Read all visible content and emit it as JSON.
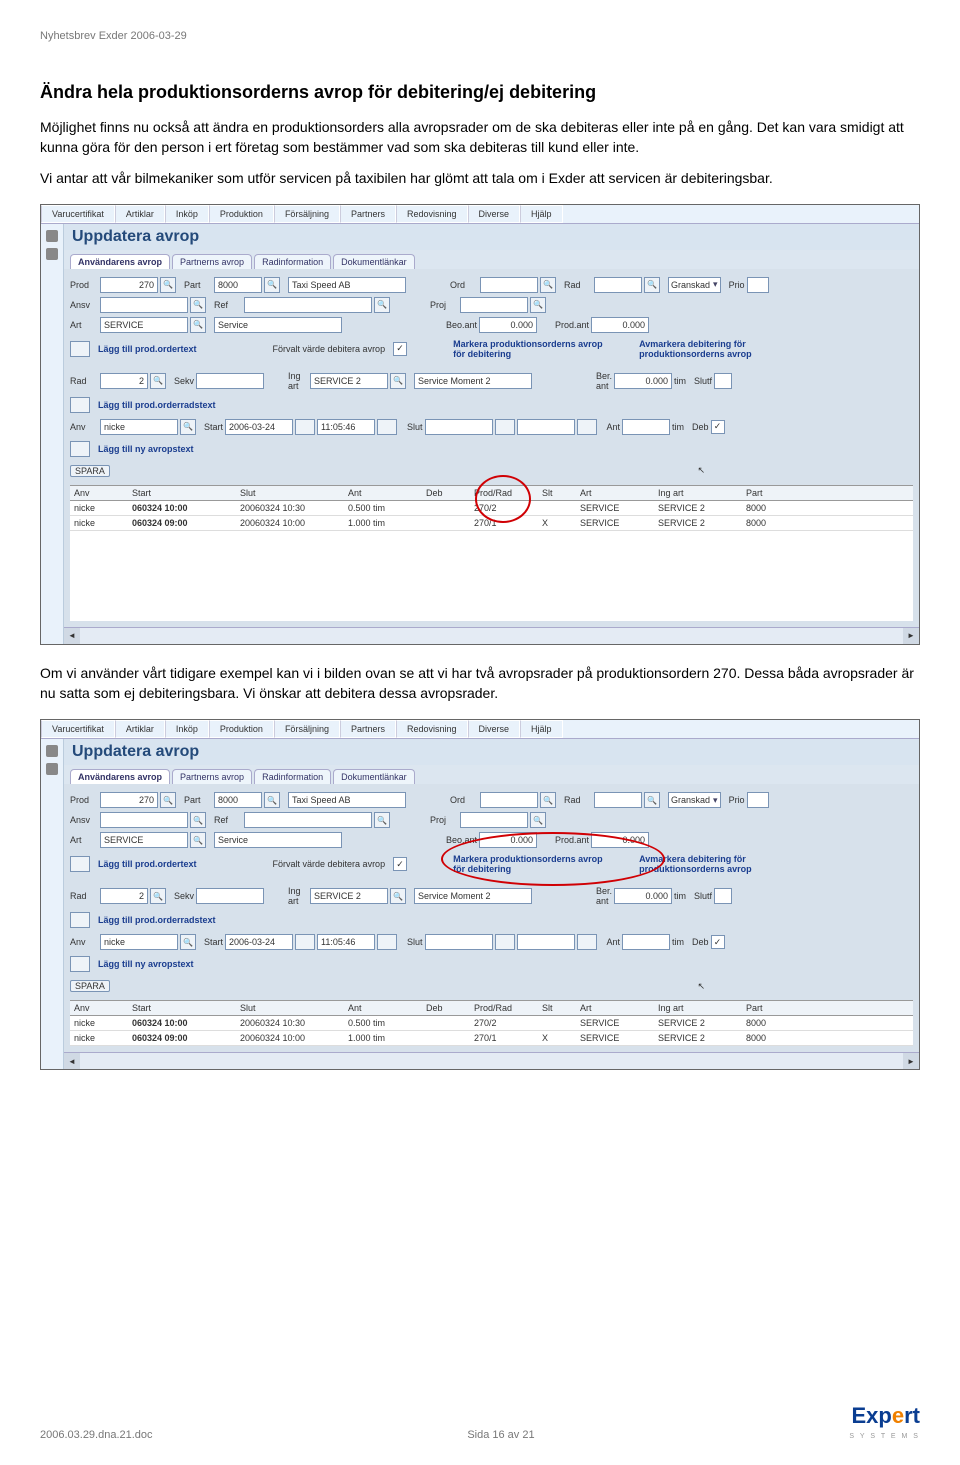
{
  "doc": {
    "header": "Nyhetsbrev Exder 2006-03-29",
    "title": "Ändra hela produktionsorderns avrop för debitering/ej debitering",
    "para1": "Möjlighet finns nu också att ändra en produktionsorders alla avropsrader om de ska debiteras eller inte på en gång. Det kan vara smidigt att kunna göra för den person i ert företag som bestämmer vad som ska debiteras till kund eller inte.",
    "para2": "Vi antar att vår bilmekaniker som utför servicen på taxibilen har glömt att tala om i Exder att servicen är debiteringsbar.",
    "para3": "Om vi använder vårt tidigare exempel kan vi i bilden ovan se att vi har två avropsrader på produktionsordern 270. Dessa båda avropsrader är nu satta som ej debiteringsbara. Vi önskar att debitera dessa avropsrader.",
    "footer_left": "2006.03.29.dna.21.doc",
    "footer_mid": "Sida 16 av 21",
    "logo_main": "Expert",
    "logo_sub": "S Y S T E M S"
  },
  "ui": {
    "menubar": [
      "Varucertifikat",
      "Artiklar",
      "Inköp",
      "Produktion",
      "Försäljning",
      "Partners",
      "Redovisning",
      "Diverse",
      "Hjälp"
    ],
    "screen_title": "Uppdatera avrop",
    "tabs": [
      "Användarens avrop",
      "Partnerns avrop",
      "Radinformation",
      "Dokumentlänkar"
    ],
    "labels": {
      "prod": "Prod",
      "part": "Part",
      "ord": "Ord",
      "rad": "Rad",
      "granskad": "Granskad",
      "prio": "Prio",
      "ansv": "Ansv",
      "ref": "Ref",
      "proj": "Proj",
      "art": "Art",
      "beo_ant": "Beo.ant",
      "prod_ant": "Prod.ant",
      "rad2": "Rad",
      "sekv": "Sekv",
      "ing_art": "Ing\nart",
      "ber_ant": "Ber.\nant",
      "tim": "tim",
      "slutf": "Slutf",
      "anv": "Anv",
      "start": "Start",
      "slut": "Slut",
      "ant": "Ant",
      "deb": "Deb"
    },
    "values": {
      "prod": "270",
      "part": "8000",
      "part_name": "Taxi Speed AB",
      "art": "SERVICE",
      "art_desc": "Service",
      "beo_ant": "0.000",
      "prod_ant": "0.000",
      "rad2": "2",
      "ing_art": "SERVICE 2",
      "ing_desc": "Service Moment 2",
      "ber_ant": "0.000",
      "anv": "nicke",
      "start_date": "2006-03-24",
      "start_time": "11:05:46"
    },
    "links": {
      "ordertext": "Lägg till prod.ordertext",
      "forvalt": "Förvalt värde debitera avrop",
      "mark": "Markera produktionsorderns avrop för debitering",
      "avmark": "Avmarkera debitering för produktionsorderns avrop",
      "orderradstext": "Lägg till prod.orderradstext",
      "avropstext": "Lägg till ny avropstext",
      "spara": "SPARA"
    },
    "table": {
      "headers": [
        "Anv",
        "Start",
        "Slut",
        "Ant",
        "Deb",
        "Prod/Rad",
        "Slt",
        "Art",
        "Ing art",
        "Part"
      ],
      "rows": [
        {
          "anv": "nicke",
          "start": "060324 10:00",
          "slut": "20060324 10:30",
          "ant": "0.500 tim",
          "deb": "",
          "prodrad": "270/2",
          "slt": "",
          "art": "SERVICE",
          "ing": "SERVICE 2",
          "part": "8000"
        },
        {
          "anv": "nicke",
          "start": "060324 09:00",
          "slut": "20060324 10:00",
          "ant": "1.000 tim",
          "deb": "",
          "prodrad": "270/1",
          "slt": "X",
          "art": "SERVICE",
          "ing": "SERVICE 2",
          "part": "8000"
        }
      ]
    }
  }
}
